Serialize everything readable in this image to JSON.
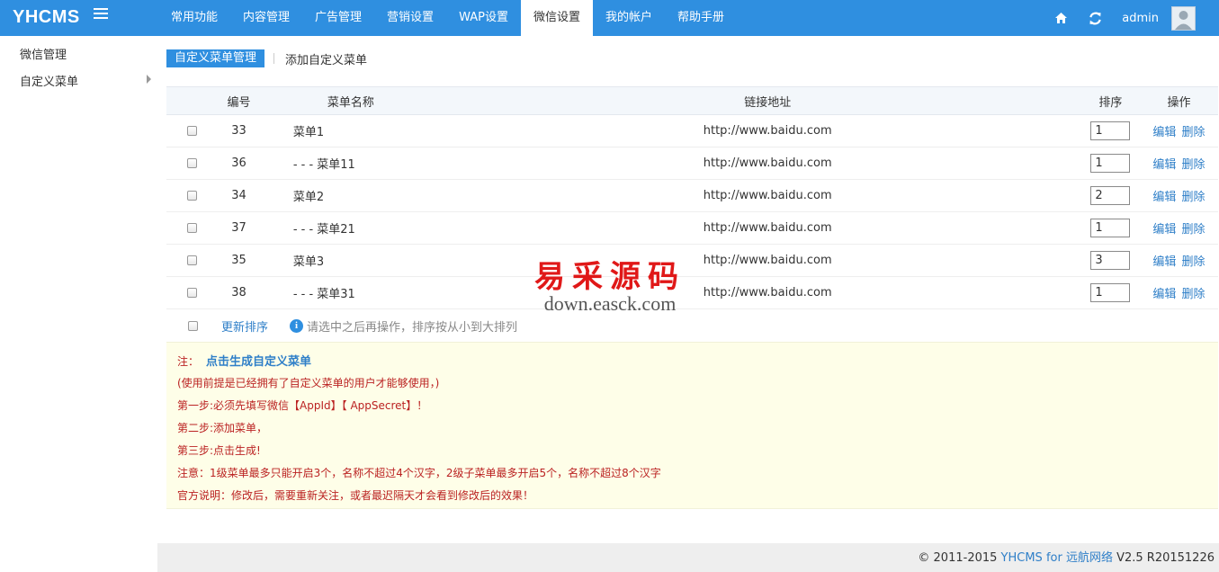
{
  "brand": "YHCMS",
  "nav": {
    "tabs": [
      "常用功能",
      "内容管理",
      "广告管理",
      "营销设置",
      "WAP设置",
      "微信设置",
      "我的帐户",
      "帮助手册"
    ],
    "active": "微信设置"
  },
  "topbar": {
    "username": "admin"
  },
  "sidebar": {
    "items": [
      "微信管理",
      "自定义菜单"
    ]
  },
  "subtabs": {
    "active": "自定义菜单管理",
    "other": "添加自定义菜单"
  },
  "table": {
    "headers": [
      "编号",
      "菜单名称",
      "链接地址",
      "排序",
      "操作"
    ],
    "rows": [
      {
        "id": "33",
        "name": "菜单1",
        "url": "http://www.baidu.com",
        "sort": "1"
      },
      {
        "id": "36",
        "name": "- - - 菜单11",
        "url": "http://www.baidu.com",
        "sort": "1"
      },
      {
        "id": "34",
        "name": "菜单2",
        "url": "http://www.baidu.com",
        "sort": "2"
      },
      {
        "id": "37",
        "name": "- - - 菜单21",
        "url": "http://www.baidu.com",
        "sort": "1"
      },
      {
        "id": "35",
        "name": "菜单3",
        "url": "http://www.baidu.com",
        "sort": "3"
      },
      {
        "id": "38",
        "name": "- - - 菜单31",
        "url": "http://www.baidu.com",
        "sort": "1"
      }
    ],
    "edit_label": "编辑",
    "delete_label": "删除"
  },
  "footer": {
    "update_sort": "更新排序",
    "hint": "请选中之后再操作，排序按从小到大排列"
  },
  "notes": {
    "prefix": "注：",
    "generate_link": "点击生成自定义菜单",
    "lines": [
      "(使用前提是已经拥有了自定义菜单的用户才能够使用，)",
      "第一步:必须先填写微信【AppId】【 AppSecret】！",
      "第二步:添加菜单，",
      "第三步:点击生成!",
      "注意：1级菜单最多只能开启3个，名称不超过4个汉字，2级子菜单最多开启5个，名称不超过8个汉字",
      "官方说明：修改后，需要重新关注，或者最迟隔天才会看到修改后的效果！"
    ]
  },
  "watermark": {
    "text": "易采源码",
    "url": "down.easck.com"
  },
  "copyright": {
    "prefix": "© 2011-2015",
    "link": "YHCMS for 远航网络",
    "version": "V2.5 R20151226"
  },
  "colors": {
    "primary": "#2f8fe0",
    "link": "#2f7fc8",
    "note_text": "#b22222",
    "note_bg": "#fefee8"
  }
}
